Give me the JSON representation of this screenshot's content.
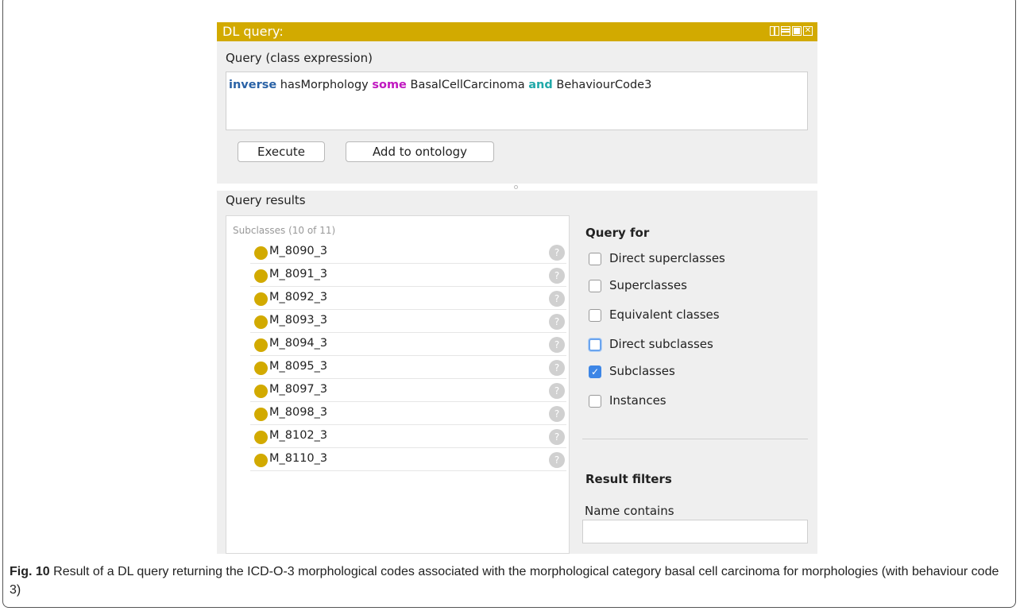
{
  "window": {
    "title": "DL query:",
    "accent_color": "#d2aa00",
    "title_buttons": [
      "split-view-icon",
      "minimize-icon",
      "maximize-icon",
      "close-icon"
    ]
  },
  "query": {
    "section_label": "Query (class expression)",
    "tokens": {
      "t1": "inverse",
      "t2": " hasMorphology ",
      "t3": "some",
      "t4": " BasalCellCarcinoma ",
      "t5": "and",
      "t6": " BehaviourCode3"
    },
    "execute_label": "Execute",
    "add_label": "Add to ontology"
  },
  "results": {
    "section_label": "Query results",
    "header": "Subclasses (10 of 11)",
    "items": [
      {
        "label": "M_8090_3"
      },
      {
        "label": "M_8091_3"
      },
      {
        "label": "M_8092_3"
      },
      {
        "label": "M_8093_3"
      },
      {
        "label": "M_8094_3"
      },
      {
        "label": "M_8095_3"
      },
      {
        "label": "M_8097_3"
      },
      {
        "label": "M_8098_3"
      },
      {
        "label": "M_8102_3"
      },
      {
        "label": "M_8110_3"
      }
    ],
    "help_glyph": "?"
  },
  "query_for": {
    "title": "Query for",
    "options": [
      {
        "label": "Direct superclasses",
        "checked": false
      },
      {
        "label": "Superclasses",
        "checked": false
      },
      {
        "label": "Equivalent classes",
        "checked": false
      },
      {
        "label": "Direct subclasses",
        "checked": false
      },
      {
        "label": "Subclasses",
        "checked": true
      },
      {
        "label": "Instances",
        "checked": false
      }
    ]
  },
  "filters": {
    "title": "Result filters",
    "name_contains_label": "Name contains",
    "name_contains_value": ""
  },
  "caption": {
    "fig_label": "Fig. 10",
    "text": " Result of a DL query returning the ICD-O-3 morphological codes associated with the morphological category basal cell carcinoma for morphologies (with behaviour code 3)"
  }
}
